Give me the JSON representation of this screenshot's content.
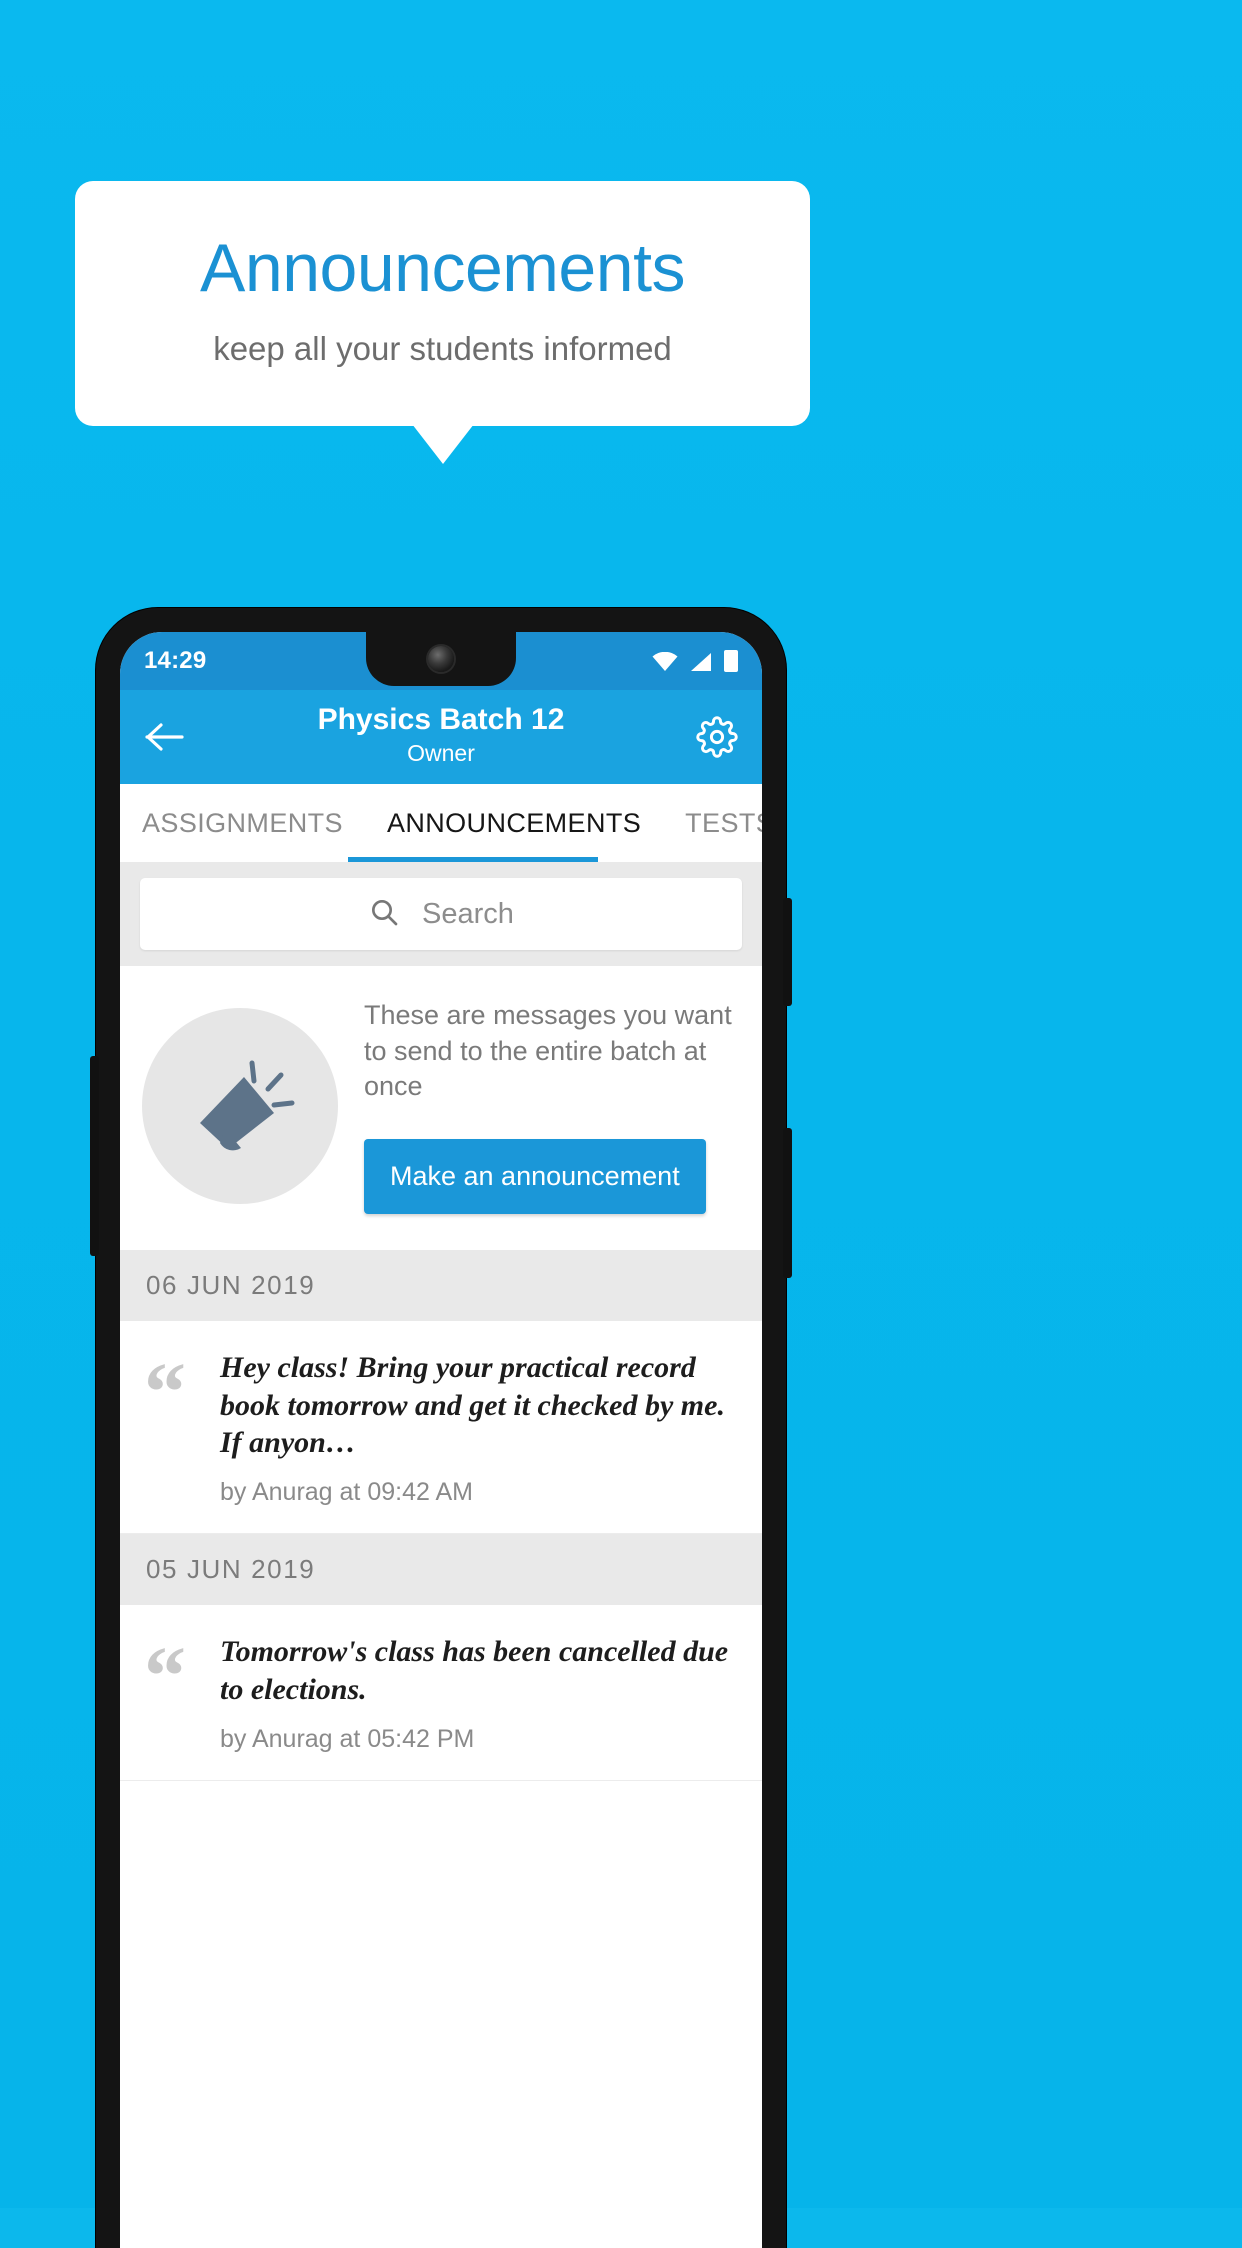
{
  "promo": {
    "title": "Announcements",
    "subtitle": "keep all your students informed",
    "title_color": "#1b91d3",
    "background_color": "#0ab9ef"
  },
  "phone": {
    "statusbar": {
      "clock": "14:29",
      "icons": [
        "wifi-icon",
        "signal-icon",
        "battery-icon"
      ],
      "background_color": "#1b8fd1"
    },
    "appbar": {
      "back_icon": "back-arrow-icon",
      "title": "Physics Batch 12",
      "subtitle": "Owner",
      "settings_icon": "gear-icon",
      "background_color": "#1aa3e0"
    },
    "tabs": {
      "items": [
        {
          "label": "ASSIGNMENTS",
          "active": false
        },
        {
          "label": "ANNOUNCEMENTS",
          "active": true
        },
        {
          "label": "TESTS",
          "active": false
        },
        {
          "label": "’",
          "active": false
        }
      ],
      "indicator_color": "#1b97d8"
    },
    "search": {
      "icon": "search-icon",
      "placeholder": "Search",
      "value": ""
    },
    "empty_promo": {
      "icon": "megaphone-icon",
      "text": "These are messages you want to send to the entire batch at once",
      "button_label": "Make an announcement",
      "button_color": "#1b97d8"
    },
    "groups": [
      {
        "date": "06  JUN  2019",
        "items": [
          {
            "quote_icon": "quote-icon",
            "text": "Hey class! Bring your practical record book tomorrow and get it checked by me. If anyon…",
            "meta": "by Anurag at 09:42 AM"
          }
        ]
      },
      {
        "date": "05  JUN  2019",
        "items": [
          {
            "quote_icon": "quote-icon",
            "text": "Tomorrow's class has been cancelled due to elections.",
            "meta": "by Anurag at 05:42 PM"
          }
        ]
      }
    ]
  }
}
